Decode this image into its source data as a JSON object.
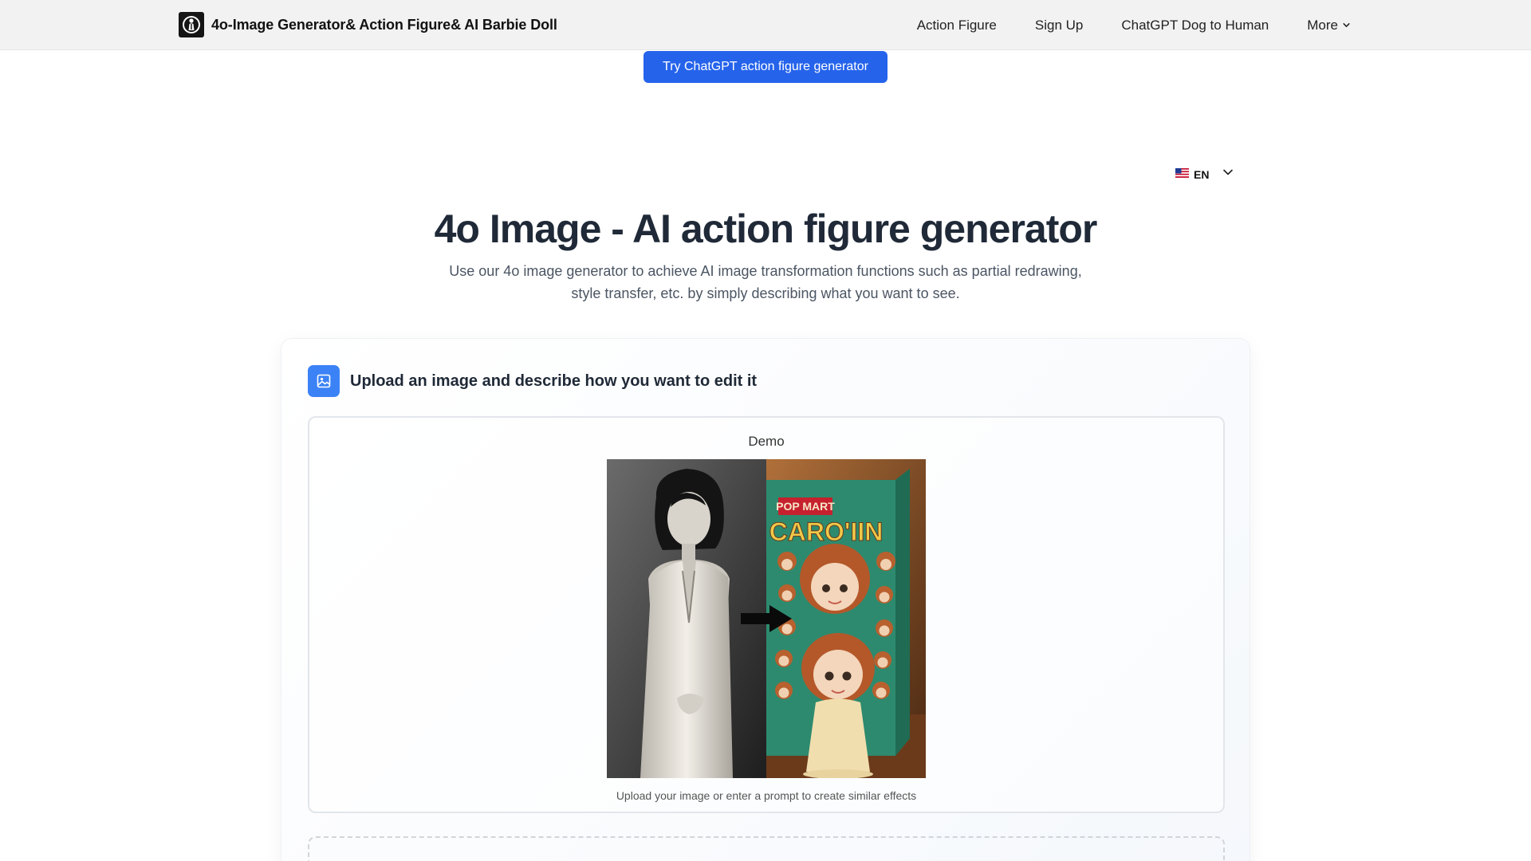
{
  "header": {
    "brand_name": "4o-Image Generator& Action Figure& AI Barbie Doll",
    "logo_icon": "figure-logo-icon",
    "nav": [
      {
        "label": "Action Figure"
      },
      {
        "label": "Sign Up"
      },
      {
        "label": "ChatGPT Dog to Human"
      },
      {
        "label": "More",
        "icon": "chevron-down-icon"
      }
    ]
  },
  "promo": {
    "label": "Try ChatGPT action figure generator",
    "color": "#2563eb"
  },
  "language": {
    "code": "EN",
    "flag_icon": "us-flag-icon"
  },
  "hero": {
    "title": "4o Image - AI action figure generator",
    "subtitle": "Use our 4o image generator to achieve AI image transformation functions such as partial redrawing, style transfer, etc. by simply describing what you want to see."
  },
  "editor": {
    "title": "Upload an image and describe how you want to edit it",
    "icon": "image-icon",
    "accent": "#3b82f6",
    "demo": {
      "label": "Demo",
      "caption": "Upload your image or enter a prompt to create similar effects",
      "box_text_top": "POP MART",
      "box_text_main": "CARO'IIN"
    }
  }
}
